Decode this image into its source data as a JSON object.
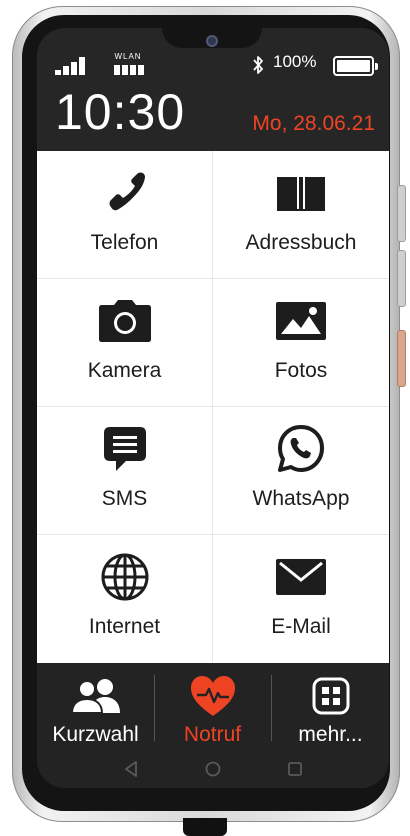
{
  "status": {
    "wlan_label": "WLAN",
    "battery": "100%",
    "battery_level": 1.0,
    "time": "10:30",
    "date": "Mo, 28.06.21"
  },
  "tiles": [
    {
      "label": "Telefon",
      "icon": "phone-handset-icon"
    },
    {
      "label": "Adressbuch",
      "icon": "address-book-icon"
    },
    {
      "label": "Kamera",
      "icon": "camera-icon"
    },
    {
      "label": "Fotos",
      "icon": "photos-icon"
    },
    {
      "label": "SMS",
      "icon": "sms-bubble-icon"
    },
    {
      "label": "WhatsApp",
      "icon": "whatsapp-icon"
    },
    {
      "label": "Internet",
      "icon": "globe-icon"
    },
    {
      "label": "E-Mail",
      "icon": "envelope-icon"
    }
  ],
  "dock": [
    {
      "label": "Kurzwahl",
      "icon": "contacts-people-icon",
      "color": "#ffffff"
    },
    {
      "label": "Notruf",
      "icon": "heart-pulse-icon",
      "color": "#ef4423"
    },
    {
      "label": "mehr...",
      "icon": "apps-grid-icon",
      "color": "#ffffff"
    }
  ],
  "colors": {
    "accent": "#ef4423",
    "screen_dark": "#262626",
    "tile_bg": "#ffffff"
  }
}
